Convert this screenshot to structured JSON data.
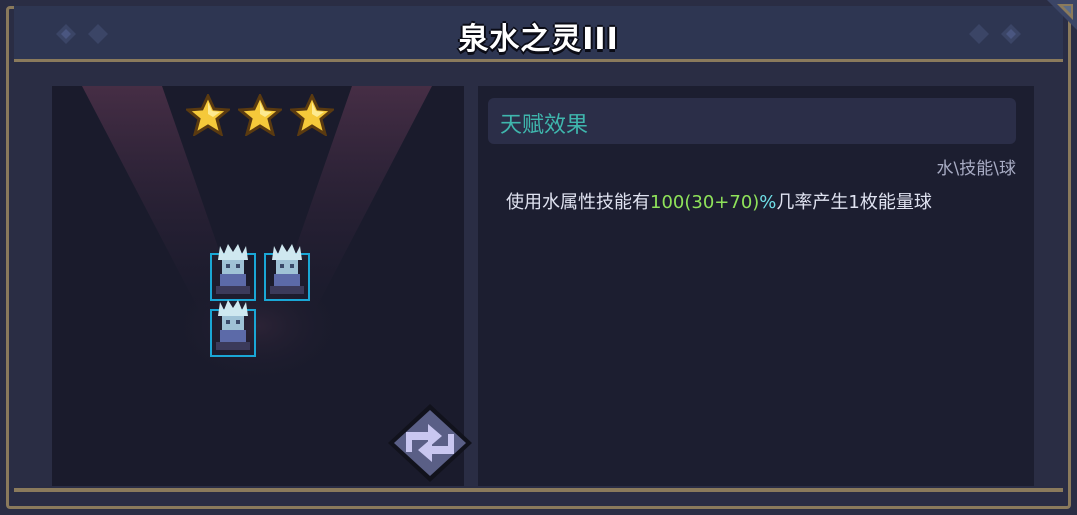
{
  "window": {
    "title": "泉水之灵III"
  },
  "unit_card": {
    "star_count": 3,
    "unit_count": 3,
    "icons": {
      "star": "star-icon",
      "unit": "water-spirit-sprite",
      "swap": "swap-arrows-icon"
    },
    "colors": {
      "star": "#f5c93a",
      "unit_frame": "#1aa7d6"
    }
  },
  "talent": {
    "header": "天赋效果",
    "tags": "水\\技能\\球",
    "description": {
      "prefix": "使用水属性技能有",
      "value": "100(30+70)",
      "percent": "%",
      "suffix": "几率产生1枚能量球"
    },
    "colors": {
      "header": "#3fb6ad",
      "value": "#8fe35a",
      "percent": "#6fe0e8"
    }
  }
}
